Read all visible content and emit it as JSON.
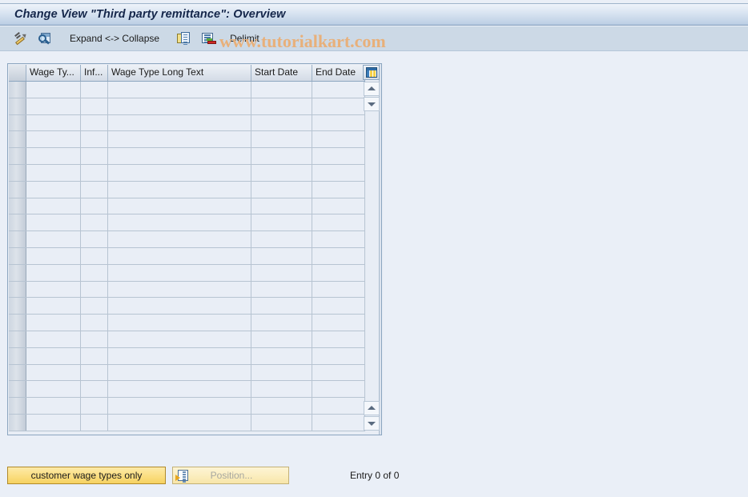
{
  "window": {
    "title": "Change View \"Third party remittance\": Overview"
  },
  "watermark": {
    "text": "www.tutorialkart.com",
    "color": "#e8b07a"
  },
  "toolbar": {
    "items": [
      {
        "id": "display-change",
        "icon": "pencil-icon",
        "label": ""
      },
      {
        "id": "details",
        "icon": "magnifier-document-icon",
        "label": ""
      },
      {
        "id": "expand-collapse",
        "icon": "",
        "label": "Expand <-> Collapse"
      },
      {
        "id": "copy-as",
        "icon": "copy-icon",
        "label": ""
      },
      {
        "id": "delimit-row",
        "icon": "delimit-icon",
        "label": ""
      },
      {
        "id": "delimit",
        "icon": "",
        "label": "Delimit"
      }
    ]
  },
  "table": {
    "settings_icon": "table-settings-icon",
    "columns": [
      {
        "key": "select",
        "label": ""
      },
      {
        "key": "wagetype",
        "label": "Wage Ty..."
      },
      {
        "key": "infotype",
        "label": "Inf..."
      },
      {
        "key": "longtext",
        "label": "Wage Type Long Text"
      },
      {
        "key": "startdate",
        "label": "Start Date"
      },
      {
        "key": "enddate",
        "label": "End Date"
      }
    ],
    "rows": [],
    "empty_row_count": 21,
    "scroll": {
      "top_up": "scroll-up-icon",
      "top_down": "scroll-down-icon",
      "bottom_up": "scroll-up-icon",
      "bottom_down": "scroll-down-icon"
    }
  },
  "footer": {
    "customer_wage_types_label": "customer wage types only",
    "position_label": "Position...",
    "position_icon": "position-icon",
    "position_enabled": false,
    "entry_status": "Entry 0 of 0"
  },
  "colors": {
    "page_background": "#eaeff7",
    "toolbar_background": "#ccd9e6",
    "title_text": "#14264a",
    "accent_yellow": "#f6d261",
    "grid_cell": "#e9eef6"
  }
}
